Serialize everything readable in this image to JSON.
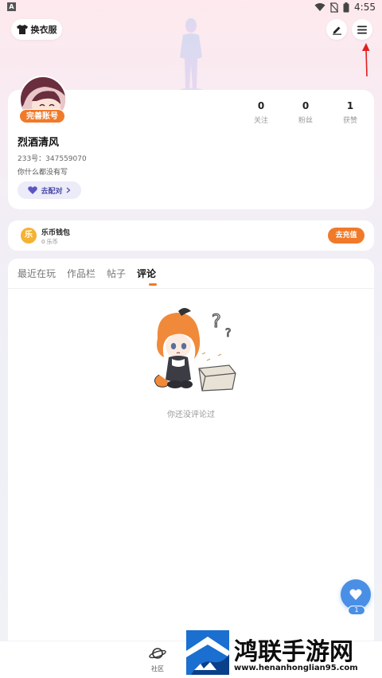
{
  "status_bar": {
    "app_icon_letter": "A",
    "time": "4:55",
    "icons": [
      "wifi-icon",
      "no-sim-icon",
      "battery-icon"
    ]
  },
  "header": {
    "outfit_button_label": "换衣服",
    "edit_icon": "pencil-icon",
    "menu_icon": "hamburger-menu-icon"
  },
  "profile": {
    "complete_badge": "完善账号",
    "username": "烈酒清风",
    "uid": "233号：347559070",
    "bio": "你什么都没有写",
    "match_button": "去配对",
    "stats": [
      {
        "value": "0",
        "label": "关注"
      },
      {
        "value": "0",
        "label": "粉丝"
      },
      {
        "value": "1",
        "label": "获赞"
      }
    ]
  },
  "wallet": {
    "icon_char": "乐",
    "title": "乐币钱包",
    "balance": "0 乐币",
    "recharge_button": "去充值"
  },
  "tabs": [
    {
      "label": "最近在玩",
      "active": false
    },
    {
      "label": "作品栏",
      "active": false
    },
    {
      "label": "帖子",
      "active": false
    },
    {
      "label": "评论",
      "active": true
    }
  ],
  "empty_state": {
    "text": "你还没评论过"
  },
  "fab": {
    "count": "1"
  },
  "bottom_nav": {
    "community_label": "社区"
  },
  "watermark": {
    "title": "鸿联手游网",
    "url": "www.henanhonglian95.com"
  },
  "colors": {
    "accent_orange": "#f07a2a",
    "accent_blue": "#4a8fe6",
    "match_purple": "#4b4aa8"
  }
}
